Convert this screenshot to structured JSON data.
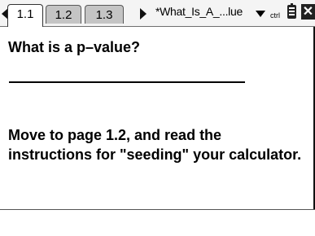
{
  "tabs": [
    {
      "label": "1.1",
      "active": true
    },
    {
      "label": "1.2",
      "active": false
    },
    {
      "label": "1.3",
      "active": false
    }
  ],
  "document": {
    "title": "*What_Is_A_...lue",
    "ctrl_indicator": "ctrl",
    "close_glyph": "✕"
  },
  "icons": {
    "nav_left": "triangle-left",
    "nav_right": "triangle-right",
    "dropdown": "triangle-down",
    "battery": "battery-icon",
    "close": "close-icon"
  },
  "page": {
    "heading": "What is a p–value?",
    "instruction_line1": "Move to page 1.2, and read the",
    "instruction_line2": "instructions for \"seeding\" your calculator."
  }
}
